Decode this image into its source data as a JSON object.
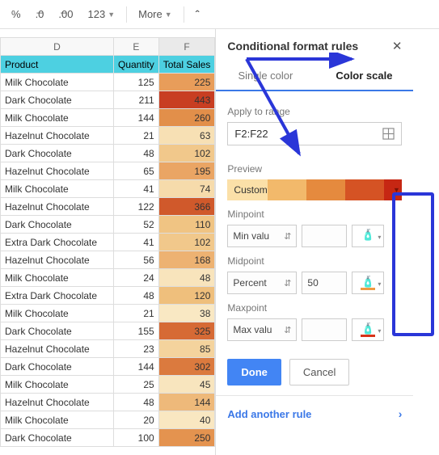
{
  "toolbar": {
    "percent": "%",
    "dec_dec": ".0",
    "dec_inc": ".00",
    "num_fmt": "123",
    "more": "More",
    "chevron_up": "ˆ"
  },
  "panel": {
    "title": "Conditional format rules",
    "tab_single": "Single color",
    "tab_scale": "Color scale",
    "apply_label": "Apply to range",
    "range_value": "F2:F22",
    "preview_label": "Preview",
    "preview_text": "Custom",
    "min_label": "Minpoint",
    "min_type": "Min valu",
    "mid_label": "Midpoint",
    "mid_type": "Percent",
    "mid_val": "50",
    "max_label": "Maxpoint",
    "max_type": "Max valu",
    "done": "Done",
    "cancel": "Cancel",
    "add_rule": "Add another rule"
  },
  "columns": [
    "D",
    "E",
    "F"
  ],
  "header_row": [
    "Product",
    "Quantity",
    "Total Sales"
  ],
  "rows": [
    {
      "p": "Milk Chocolate",
      "q": 125,
      "s": 225,
      "c": "#e89d5a"
    },
    {
      "p": "Dark Chocolate",
      "q": 211,
      "s": 443,
      "c": "#c83e22"
    },
    {
      "p": "Milk Chocolate",
      "q": 144,
      "s": 260,
      "c": "#e28f4a"
    },
    {
      "p": "Hazelnut Chocolate",
      "q": 21,
      "s": 63,
      "c": "#f7e0b4"
    },
    {
      "p": "Dark Chocolate",
      "q": 48,
      "s": 102,
      "c": "#f1c88b"
    },
    {
      "p": "Hazelnut Chocolate",
      "q": 65,
      "s": 195,
      "c": "#eaa564"
    },
    {
      "p": "Milk Chocolate",
      "q": 41,
      "s": 74,
      "c": "#f6dbab"
    },
    {
      "p": "Hazelnut Chocolate",
      "q": 122,
      "s": 366,
      "c": "#d0592b"
    },
    {
      "p": "Dark Chocolate",
      "q": 52,
      "s": 110,
      "c": "#f0c483"
    },
    {
      "p": "Extra Dark Chocolate",
      "q": 41,
      "s": 102,
      "c": "#f1c88b"
    },
    {
      "p": "Hazelnut Chocolate",
      "q": 56,
      "s": 168,
      "c": "#edb272"
    },
    {
      "p": "Milk Chocolate",
      "q": 24,
      "s": 48,
      "c": "#f8e4bc"
    },
    {
      "p": "Extra Dark Chocolate",
      "q": 48,
      "s": 120,
      "c": "#efbf7c"
    },
    {
      "p": "Milk Chocolate",
      "q": 21,
      "s": 38,
      "c": "#f9e8c3"
    },
    {
      "p": "Dark Chocolate",
      "q": 155,
      "s": 325,
      "c": "#d66a35"
    },
    {
      "p": "Hazelnut Chocolate",
      "q": 23,
      "s": 85,
      "c": "#f4d39d"
    },
    {
      "p": "Dark Chocolate",
      "q": 144,
      "s": 302,
      "c": "#db7a3e"
    },
    {
      "p": "Milk Chocolate",
      "q": 25,
      "s": 45,
      "c": "#f8e5be"
    },
    {
      "p": "Hazelnut Chocolate",
      "q": 48,
      "s": 144,
      "c": "#eeb97a"
    },
    {
      "p": "Milk Chocolate",
      "q": 20,
      "s": 40,
      "c": "#f9e7c1"
    },
    {
      "p": "Dark Chocolate",
      "q": 100,
      "s": 250,
      "c": "#e4934f"
    }
  ],
  "chart_data": {
    "type": "table",
    "title": "Conditional format color scale on Total Sales",
    "columns": [
      "Product",
      "Quantity",
      "Total Sales"
    ],
    "range": "F2:F22",
    "scale": {
      "min_color": "#f9e8c3",
      "mid_color": "#e89d5a",
      "max_color": "#c83e22",
      "midpoint_percent": 50
    },
    "data": [
      [
        "Milk Chocolate",
        125,
        225
      ],
      [
        "Dark Chocolate",
        211,
        443
      ],
      [
        "Milk Chocolate",
        144,
        260
      ],
      [
        "Hazelnut Chocolate",
        21,
        63
      ],
      [
        "Dark Chocolate",
        48,
        102
      ],
      [
        "Hazelnut Chocolate",
        65,
        195
      ],
      [
        "Milk Chocolate",
        41,
        74
      ],
      [
        "Hazelnut Chocolate",
        122,
        366
      ],
      [
        "Dark Chocolate",
        52,
        110
      ],
      [
        "Extra Dark Chocolate",
        41,
        102
      ],
      [
        "Hazelnut Chocolate",
        56,
        168
      ],
      [
        "Milk Chocolate",
        24,
        48
      ],
      [
        "Extra Dark Chocolate",
        48,
        120
      ],
      [
        "Milk Chocolate",
        21,
        38
      ],
      [
        "Dark Chocolate",
        155,
        325
      ],
      [
        "Hazelnut Chocolate",
        23,
        85
      ],
      [
        "Dark Chocolate",
        144,
        302
      ],
      [
        "Milk Chocolate",
        25,
        45
      ],
      [
        "Hazelnut Chocolate",
        48,
        144
      ],
      [
        "Milk Chocolate",
        20,
        40
      ],
      [
        "Dark Chocolate",
        100,
        250
      ]
    ]
  }
}
